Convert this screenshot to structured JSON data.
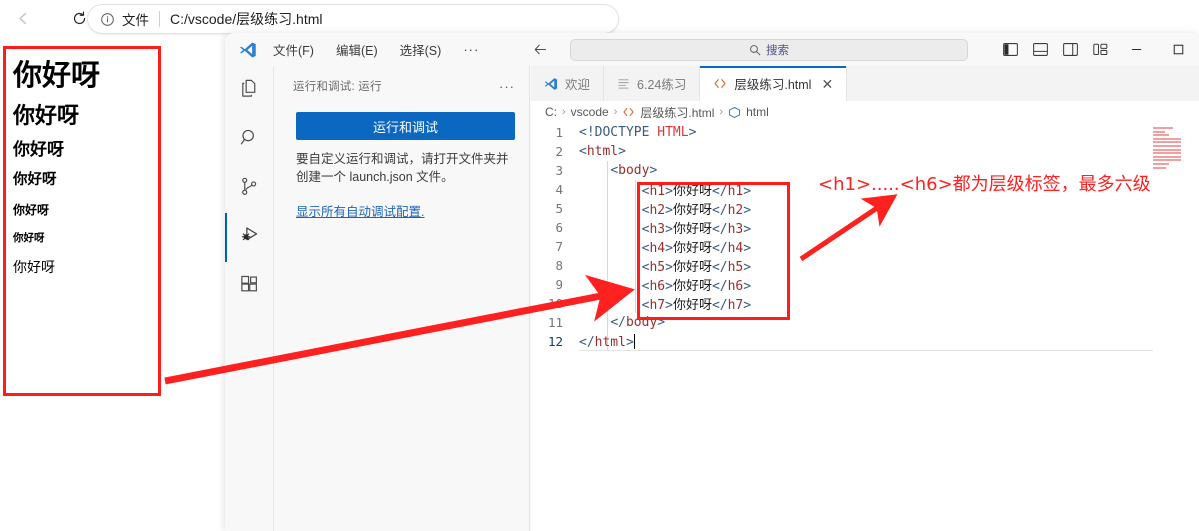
{
  "browser": {
    "back_icon": "arrow-left-icon",
    "reload_icon": "reload-icon",
    "info_icon": "info-circle-icon",
    "file_label": "文件",
    "url": "C:/vscode/层级练习.html"
  },
  "page_render": {
    "headings": [
      {
        "tag": "h1",
        "text": "你好呀"
      },
      {
        "tag": "h2",
        "text": "你好呀"
      },
      {
        "tag": "h3",
        "text": "你好呀"
      },
      {
        "tag": "h4",
        "text": "你好呀"
      },
      {
        "tag": "h5",
        "text": "你好呀"
      },
      {
        "tag": "h6",
        "text": "你好呀"
      },
      {
        "tag": "h7",
        "text": "你好呀"
      }
    ]
  },
  "vscode": {
    "titlebar": {
      "logo_icon": "vscode-logo-icon",
      "menus": [
        "文件(F)",
        "编辑(E)",
        "选择(S)"
      ],
      "more_label": "···",
      "back_icon": "nav-back-icon",
      "forward_icon": "nav-forward-icon",
      "search_icon": "search-icon",
      "search_placeholder": "搜索",
      "layout_icons": [
        "toggle-primary-sidebar-icon",
        "toggle-panel-icon",
        "toggle-secondary-sidebar-icon",
        "customize-layout-icon"
      ],
      "minimize_label": "—",
      "maximize_label": "☐"
    },
    "activity_bar": [
      {
        "name": "explorer",
        "icon": "files-icon",
        "active": false
      },
      {
        "name": "search",
        "icon": "search-icon",
        "active": false
      },
      {
        "name": "source-control",
        "icon": "source-control-icon",
        "active": false
      },
      {
        "name": "run-and-debug",
        "icon": "run-debug-icon",
        "active": true
      },
      {
        "name": "extensions",
        "icon": "extensions-icon",
        "active": false
      }
    ],
    "side_panel": {
      "title": "运行和调试: 运行",
      "more_label": "···",
      "run_button": "运行和调试",
      "description": "要自定义运行和调试，请打开文件夹并创建一个 launch.json 文件。",
      "link": "显示所有自动调试配置."
    },
    "tabs": [
      {
        "label": "欢迎",
        "icon": "vscode-logo-icon",
        "active": false,
        "closable": false
      },
      {
        "label": "6.24练习",
        "icon": "text-file-icon",
        "active": false,
        "closable": false
      },
      {
        "label": "层级练习.html",
        "icon": "html-file-icon",
        "active": true,
        "closable": true,
        "close_label": "✕"
      }
    ],
    "breadcrumb": [
      {
        "label": "C:",
        "icon": null
      },
      {
        "label": "vscode",
        "icon": null
      },
      {
        "label": "层级练习.html",
        "icon": "html-file-icon"
      },
      {
        "label": "html",
        "icon": "symbol-html-icon"
      }
    ],
    "breadcrumb_separator": "›",
    "code_lines": [
      {
        "num": "1",
        "indent": 0,
        "content": "<!DOCTYPE HTML>"
      },
      {
        "num": "2",
        "indent": 0,
        "content": "<html>"
      },
      {
        "num": "3",
        "indent": 1,
        "content": "<body>"
      },
      {
        "num": "4",
        "indent": 2,
        "content": "<h1>你好呀</h1>"
      },
      {
        "num": "5",
        "indent": 2,
        "content": "<h2>你好呀</h2>"
      },
      {
        "num": "6",
        "indent": 2,
        "content": "<h3>你好呀</h3>"
      },
      {
        "num": "7",
        "indent": 2,
        "content": "<h4>你好呀</h4>"
      },
      {
        "num": "8",
        "indent": 2,
        "content": "<h5>你好呀</h5>"
      },
      {
        "num": "9",
        "indent": 2,
        "content": "<h6>你好呀</h6>"
      },
      {
        "num": "10",
        "indent": 2,
        "content": "<h7>你好呀</h7>"
      },
      {
        "num": "11",
        "indent": 1,
        "content": "</body>"
      },
      {
        "num": "12",
        "indent": 0,
        "content": "</html>"
      }
    ]
  },
  "annotations": {
    "note_text": "<h1>.....<h6>都为层级标签，最多六级",
    "color": "#ff2020",
    "arrow_long": "arrow-from-browser-output-to-code",
    "arrow_short": "arrow-to-note-text"
  }
}
